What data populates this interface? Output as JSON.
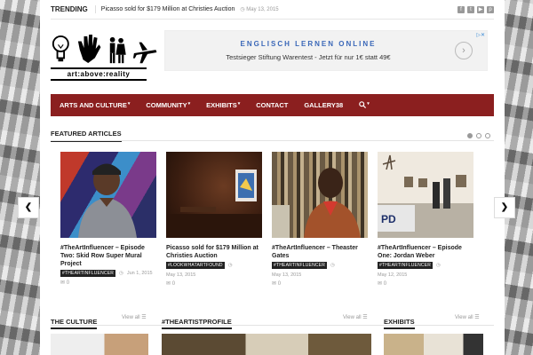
{
  "topbar": {
    "trending_label": "TRENDING",
    "trending_title": "Picasso sold for $179 Million at Christies Auction",
    "trending_date": "May 13, 2015",
    "socials": [
      "facebook-icon",
      "twitter-icon",
      "youtube-icon",
      "pinterest-icon"
    ]
  },
  "logo": {
    "text": "art:above:reality"
  },
  "ad": {
    "title": "ENGLISCH LERNEN ONLINE",
    "subtitle": "Testsieger Stiftung Warentest - Jetzt für nur 1€ statt 49€",
    "arrow": "›"
  },
  "nav": {
    "items": [
      "ARTS AND CULTURE",
      "COMMUNITY",
      "EXHIBITS",
      "CONTACT",
      "GALLERY38"
    ]
  },
  "featured": {
    "heading": "FEATURED ARTICLES",
    "cards": [
      {
        "title": "#TheArtInfluencer – Episode Two: Skid Row Super Mural Project",
        "tag": "#THEARTINFLUENCER",
        "date": "Jun 1, 2015",
        "comments": "0"
      },
      {
        "title": "Picasso sold for $179 Million at Christies Auction",
        "tag": "#LOOKWHATARTFOUND",
        "date": "May 13, 2015",
        "comments": "0"
      },
      {
        "title": "#TheArtInfluencer – Theaster Gates",
        "tag": "#THEARTINFLUENCER",
        "date": "May 13, 2015",
        "comments": "0"
      },
      {
        "title": "#TheArtInfluencer – Episode One: Jordan Weber",
        "tag": "#THEARTINFLUENCER",
        "date": "May 12, 2015",
        "comments": "0"
      }
    ]
  },
  "bottom": {
    "sections": [
      {
        "title": "THE CULTURE",
        "viewall": "View all"
      },
      {
        "title": "#THEARTISTPROFILE",
        "viewall": "View all"
      },
      {
        "title": "EXHIBITS",
        "viewall": "View all"
      }
    ]
  },
  "colors": {
    "nav": "#8b1f1f",
    "ad_title": "#3a67b8"
  }
}
